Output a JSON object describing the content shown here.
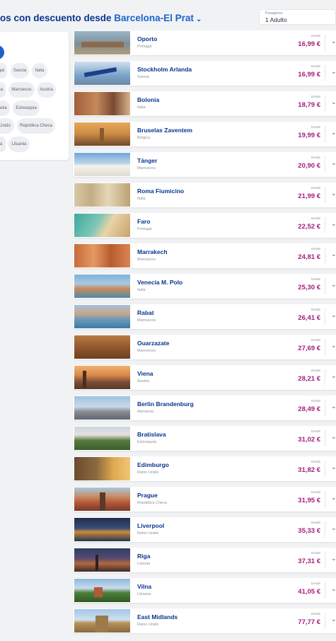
{
  "header": {
    "title_prefix": "os con descuento desde ",
    "origin": "Barcelona-El Prat",
    "chevron": "chevron-down-icon"
  },
  "passengers": {
    "label": "Pasajeros",
    "value": "1 Adulto"
  },
  "filter_chips": [
    "gal",
    "Suecia",
    "Italia",
    "ca",
    "Marruecos",
    "Austria",
    "ania",
    "Eslovaquia",
    "Unido",
    "República Checa",
    "ia",
    "Lituania"
  ],
  "price_prefix": "Desde",
  "destinations": [
    {
      "city": "Oporto",
      "country": "Portugal",
      "price": "16,99 €"
    },
    {
      "city": "Stockholm Arlanda",
      "country": "Suecia",
      "price": "16,99 €"
    },
    {
      "city": "Bolonia",
      "country": "Italia",
      "price": "18,79 €"
    },
    {
      "city": "Bruselas Zaventem",
      "country": "Bélgica",
      "price": "19,99 €"
    },
    {
      "city": "Tánger",
      "country": "Marruecos",
      "price": "20,90 €"
    },
    {
      "city": "Roma Fiumicino",
      "country": "Italia",
      "price": "21,99 €"
    },
    {
      "city": "Faro",
      "country": "Portugal",
      "price": "22,52 €"
    },
    {
      "city": "Marrakech",
      "country": "Marruecos",
      "price": "24,81 €"
    },
    {
      "city": "Venecia M. Polo",
      "country": "Italia",
      "price": "25,30 €"
    },
    {
      "city": "Rabat",
      "country": "Marruecos",
      "price": "26,41 €"
    },
    {
      "city": "Ouarzazate",
      "country": "Marruecos",
      "price": "27,69 €"
    },
    {
      "city": "Viena",
      "country": "Austria",
      "price": "28,21 €"
    },
    {
      "city": "Berlin Brandenburg",
      "country": "Alemania",
      "price": "28,49 €"
    },
    {
      "city": "Bratislava",
      "country": "Eslovaquia",
      "price": "31,02 €"
    },
    {
      "city": "Edimburgo",
      "country": "Reino Unido",
      "price": "31,82 €"
    },
    {
      "city": "Prague",
      "country": "República Checa",
      "price": "31,95 €"
    },
    {
      "city": "Liverpool",
      "country": "Reino Unido",
      "price": "35,33 €"
    },
    {
      "city": "Riga",
      "country": "Letonia",
      "price": "37,31 €"
    },
    {
      "city": "Vilna",
      "country": "Lituania",
      "price": "41,05 €"
    },
    {
      "city": "East Midlands",
      "country": "Reino Unido",
      "price": "77,77 €"
    }
  ]
}
